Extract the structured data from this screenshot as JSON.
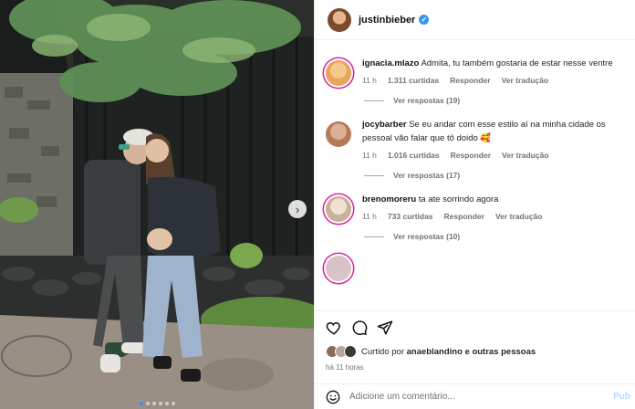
{
  "post": {
    "author": "justinbieber",
    "verified": true,
    "carousel": {
      "count": 6,
      "active_index": 0,
      "next_icon": "chevron-right-icon"
    }
  },
  "comments": [
    {
      "user": "ignacia.mlazo",
      "text": "Admita, tu também gostaria de estar nesse ventre",
      "time": "11 h",
      "likes": "1.311 curtidas",
      "reply_label": "Responder",
      "translate_label": "Ver tradução",
      "view_replies": "Ver respostas (19)",
      "avatar_color": "#e9a55a"
    },
    {
      "user": "jocybarber",
      "text": "Se eu andar com esse estilo aí na minha cidade os pessoal vão falar que tô doido 🥰",
      "time": "11 h",
      "likes": "1.016 curtidas",
      "reply_label": "Responder",
      "translate_label": "Ver tradução",
      "view_replies": "Ver respostas (17)",
      "avatar_color": "#b47a5a"
    },
    {
      "user": "brenomoreru",
      "text": "ta ate sorrindo agora",
      "time": "11 h",
      "likes": "733 curtidas",
      "reply_label": "Responder",
      "translate_label": "Ver tradução",
      "view_replies": "Ver respostas (10)",
      "avatar_color": "#c9b29a"
    }
  ],
  "actions": {
    "icons": [
      "heart-icon",
      "comment-icon",
      "share-icon"
    ]
  },
  "liked_by": {
    "prefix": "Curtido por",
    "user": "anaeblandino",
    "suffix": "e outras pessoas"
  },
  "timestamp": "há 11 horas",
  "composer": {
    "placeholder": "Adicione um comentário...",
    "post_label": "Pub"
  },
  "colors": {
    "link_blue": "#3897f0",
    "muted": "#737373",
    "story_ring": "#d6249f"
  }
}
